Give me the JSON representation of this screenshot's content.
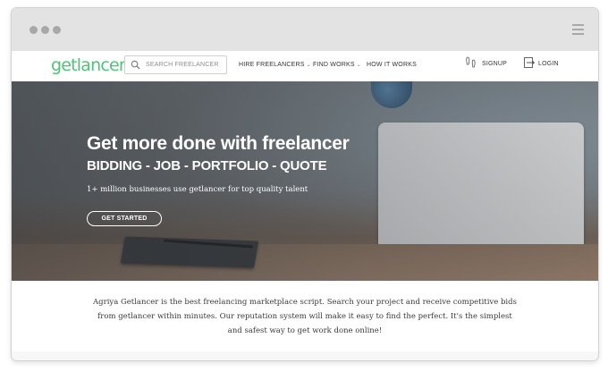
{
  "window": {
    "controls": [
      "dot",
      "dot",
      "dot"
    ],
    "menu_icon": "hamburger-icon"
  },
  "header": {
    "logo_text": "getlancer",
    "brand_color": "#4ec37a",
    "search": {
      "placeholder": "SEARCH FREELANCER",
      "value": "",
      "icon": "search-icon"
    },
    "nav": [
      {
        "label": "HIRE FREELANCERS",
        "has_dropdown": true
      },
      {
        "label": "FIND WORKS",
        "has_dropdown": true
      },
      {
        "label": "HOW IT WORKS",
        "has_dropdown": false
      }
    ],
    "signup": {
      "label": "SIGNUP",
      "icon": "footprints-icon"
    },
    "login": {
      "label": "LOGIN",
      "icon": "login-icon"
    }
  },
  "hero": {
    "title": "Get more done with freelancer",
    "subtitle": "BIDDING - JOB - PORTFOLIO - QUOTE",
    "tagline": "1+ million businesses use getlancer for top quality talent",
    "cta_label": "GET STARTED"
  },
  "intro": {
    "text": "Agriya Getlancer is the best freelancing marketplace script. Search your project and receive competitive bids from getlancer within minutes. Our reputation system will make it easy to find the perfect. It's the simplest and safest way to get work done online!"
  }
}
